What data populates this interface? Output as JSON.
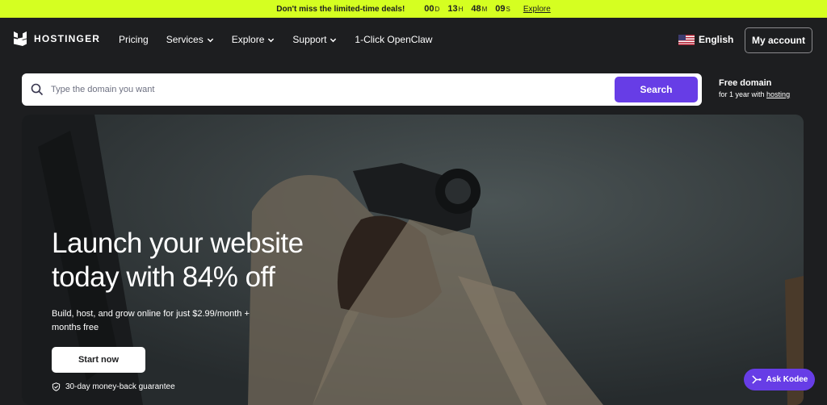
{
  "promo": {
    "text": "Don't miss the limited-time deals!",
    "countdown": [
      {
        "value": "00",
        "unit": "D"
      },
      {
        "value": "13",
        "unit": "H"
      },
      {
        "value": "48",
        "unit": "M"
      },
      {
        "value": "09",
        "unit": "S"
      }
    ],
    "explore": "Explore",
    "bg_color": "#d5ff21"
  },
  "nav": {
    "logo_text": "HOSTINGER",
    "links": [
      "Pricing",
      "Services",
      "Explore",
      "Support",
      "1-Click OpenClaw"
    ],
    "language": "English",
    "account": "My account"
  },
  "search": {
    "placeholder": "Type the domain you want",
    "button": "Search",
    "accent": "#673de6"
  },
  "free_domain": {
    "title": "Free domain",
    "subtitle_prefix": "for 1 year with",
    "link": "hosting"
  },
  "hero": {
    "title": "Launch your website today with 84% off",
    "subtitle": "Build, host, and grow online for just $2.99/month + months free",
    "cta": "Start now",
    "guarantee": "30-day money-back guarantee"
  },
  "assistant": {
    "label": "Ask Kodee"
  }
}
